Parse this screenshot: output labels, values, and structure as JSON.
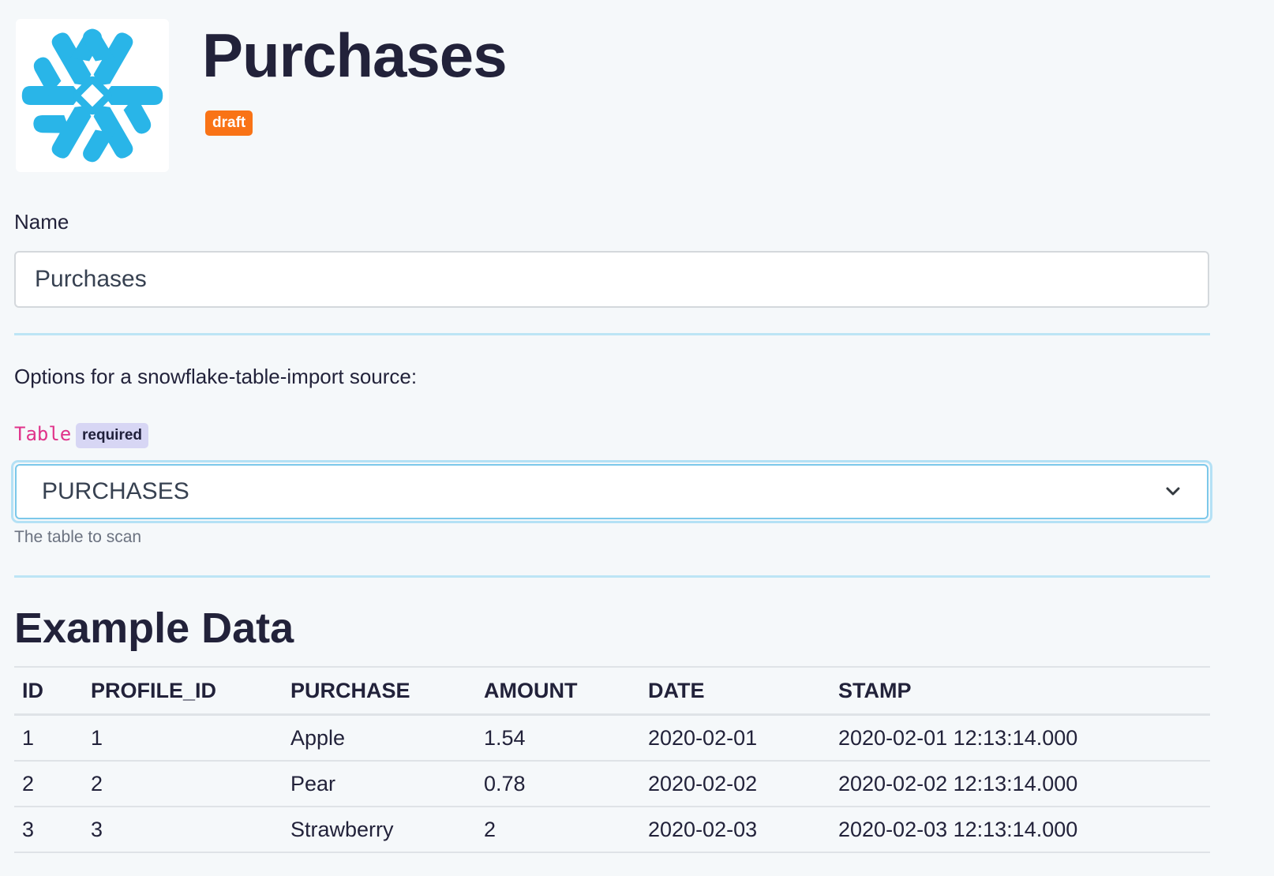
{
  "header": {
    "title": "Purchases",
    "status_badge": "draft",
    "logo_icon": "snowflake-icon",
    "logo_color": "#29b5e8",
    "badge_color": "#f97316"
  },
  "form": {
    "name_label": "Name",
    "name_value": "Purchases",
    "options_text": "Options for a snowflake-table-import source:",
    "table_field": {
      "label": "Table",
      "required_badge": "required",
      "selected_value": "PURCHASES",
      "help_text": "The table to scan",
      "icon": "chevron-down-icon"
    }
  },
  "example_data": {
    "title": "Example Data",
    "columns": [
      "ID",
      "PROFILE_ID",
      "PURCHASE",
      "AMOUNT",
      "DATE",
      "STAMP"
    ],
    "rows": [
      [
        "1",
        "1",
        "Apple",
        "1.54",
        "2020-02-01",
        "2020-02-01 12:13:14.000"
      ],
      [
        "2",
        "2",
        "Pear",
        "0.78",
        "2020-02-02",
        "2020-02-02 12:13:14.000"
      ],
      [
        "3",
        "3",
        "Strawberry",
        "2",
        "2020-02-03",
        "2020-02-03 12:13:14.000"
      ]
    ]
  }
}
